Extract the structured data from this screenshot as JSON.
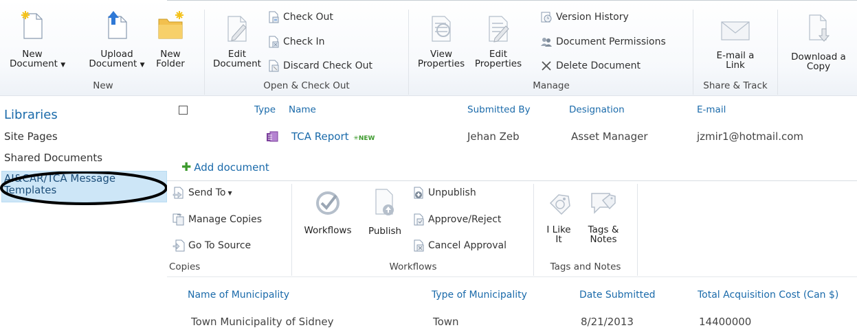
{
  "ribbon": {
    "new_group": {
      "label": "New",
      "new_document": "New Document",
      "upload_document": "Upload Document",
      "new_folder": "New Folder",
      "new_document_l1": "New",
      "new_document_l2": "Document",
      "upload_document_l1": "Upload",
      "upload_document_l2": "Document",
      "new_folder_l1": "New",
      "new_folder_l2": "Folder"
    },
    "open_group": {
      "label": "Open & Check Out",
      "edit_l1": "Edit",
      "edit_l2": "Document",
      "check_out": "Check Out",
      "check_in": "Check In",
      "discard": "Discard Check Out"
    },
    "manage_group": {
      "label": "Manage",
      "view_l1": "View",
      "view_l2": "Properties",
      "editp_l1": "Edit",
      "editp_l2": "Properties",
      "version_history": "Version History",
      "document_permissions": "Document Permissions",
      "delete_document": "Delete Document"
    },
    "share_group": {
      "label": "Share & Track",
      "email_l1": "E-mail a",
      "email_l2": "Link"
    },
    "copy_group": {
      "download_l1": "Download a",
      "download_l2": "Copy"
    }
  },
  "sidebar": {
    "heading": "Libraries",
    "items": [
      "Site Pages",
      "Shared Documents",
      "AI&CAR/TCA Message Templates"
    ],
    "selected_l1": "AI&CAR/TCA Message",
    "selected_l2": "Templates"
  },
  "doc_table": {
    "headers": [
      "Type",
      "Name",
      "Submitted By",
      "Designation",
      "E-mail"
    ],
    "row": {
      "name": "TCA Report",
      "new_badge": "NEW",
      "submitted_by": "Jehan Zeb",
      "designation": "Asset Manager",
      "email": "jzmir1@hotmail.com"
    },
    "add_document": "Add document"
  },
  "ribbon2": {
    "copies": {
      "label": "Copies",
      "send_to": "Send To",
      "manage_copies": "Manage Copies",
      "go_to_source": "Go To Source"
    },
    "workflows": {
      "label": "Workflows",
      "workflows": "Workflows",
      "publish": "Publish",
      "unpublish": "Unpublish",
      "approve_reject": "Approve/Reject",
      "cancel_approval": "Cancel Approval"
    },
    "tags": {
      "label": "Tags and Notes",
      "like_l1": "I Like",
      "like_l2": "It",
      "tags_l1": "Tags &",
      "tags_l2": "Notes"
    }
  },
  "form_table": {
    "headers": [
      "Name of Municipality",
      "Type of Municipality",
      "Date Submitted",
      "Total Acquisition Cost (Can $)"
    ],
    "row": [
      "Town Municipality of Sidney",
      "Town",
      "8/21/2013",
      "14400000"
    ]
  },
  "colors": {
    "link": "#1a6aaa",
    "selected_bg": "#cde6f7",
    "circle": "#000000"
  }
}
